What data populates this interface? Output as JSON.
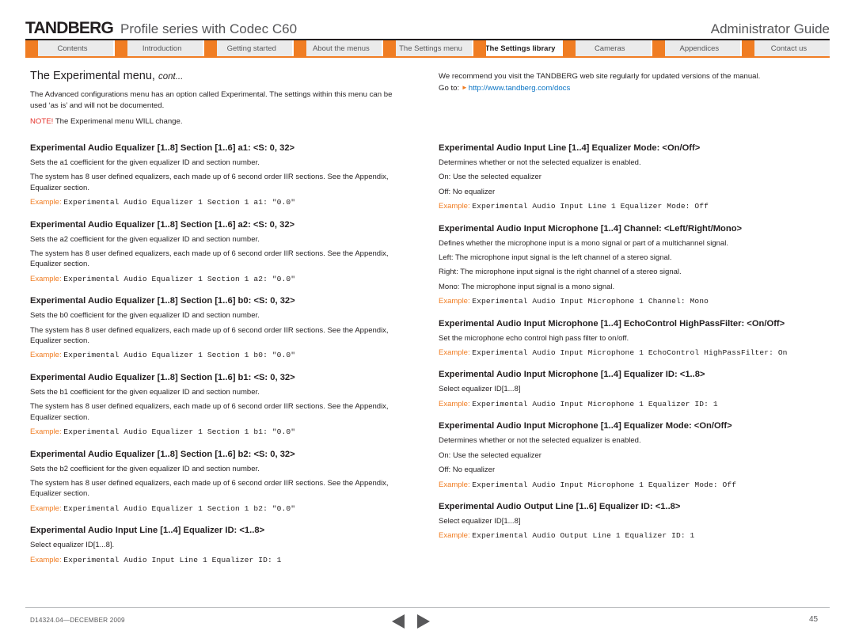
{
  "header": {
    "brand": "TANDBERG",
    "title": "Profile series with Codec C60",
    "guide": "Administrator Guide"
  },
  "tabs": [
    {
      "label": "Contents",
      "active": false
    },
    {
      "label": "Introduction",
      "active": false
    },
    {
      "label": "Getting started",
      "active": false
    },
    {
      "label": "About the menus",
      "active": false
    },
    {
      "label": "The Settings menu",
      "active": false
    },
    {
      "label": "The Settings library",
      "active": true
    },
    {
      "label": "Cameras",
      "active": false
    },
    {
      "label": "Appendices",
      "active": false
    },
    {
      "label": "Contact us",
      "active": false
    }
  ],
  "intro": {
    "title_main": "The Experimental menu, ",
    "title_cont": "cont...",
    "body": "The Advanced configurations menu has an option called Experimental. The settings within this menu can be used ‘as is’ and will not be documented.",
    "note_label": "NOTE!",
    "note_text": " The Experimenal menu WILL change.",
    "recommend": "We recommend you visit the TANDBERG web site regularly for updated versions of the manual.",
    "goto_label": "Go to:",
    "goto_link": "http://www.tandberg.com/docs"
  },
  "example_label": "Example:",
  "left_column": [
    {
      "title": "Experimental Audio Equalizer [1..8] Section [1..6] a1: <S: 0, 32>",
      "paras": [
        "Sets the a1 coefficient for the given equalizer ID and section number.",
        "The system has 8 user defined equalizers, each made up of 6 second order IIR sections. See the Appendix, Equalizer section."
      ],
      "example": "Experimental Audio Equalizer 1 Section 1 a1: \"0.0\""
    },
    {
      "title": "Experimental Audio Equalizer [1..8] Section [1..6] a2: <S: 0, 32>",
      "paras": [
        "Sets the a2 coefficient for the given equalizer ID and section number.",
        "The system has 8 user defined equalizers, each made up of 6 second order IIR sections. See the Appendix, Equalizer section."
      ],
      "example": "Experimental Audio Equalizer 1 Section 1 a2: \"0.0\""
    },
    {
      "title": "Experimental Audio Equalizer [1..8] Section [1..6] b0: <S: 0, 32>",
      "paras": [
        "Sets the b0 coefficient for the given equalizer ID and section number.",
        "The system has 8 user defined equalizers, each made up of 6 second order IIR sections. See the Appendix, Equalizer section."
      ],
      "example": "Experimental Audio Equalizer 1 Section 1 b0: \"0.0\""
    },
    {
      "title": "Experimental Audio Equalizer [1..8] Section [1..6] b1: <S: 0, 32>",
      "paras": [
        "Sets the b1 coefficient for the given equalizer ID and section number.",
        "The system has 8 user defined equalizers, each made up of 6 second order IIR sections. See the Appendix, Equalizer section."
      ],
      "example": "Experimental Audio Equalizer 1 Section 1 b1: \"0.0\""
    },
    {
      "title": "Experimental Audio Equalizer [1..8] Section [1..6] b2: <S: 0, 32>",
      "paras": [
        "Sets the b2 coefficient for the given equalizer ID and section number.",
        "The system has 8 user defined equalizers, each made up of 6 second order IIR sections. See the Appendix, Equalizer section."
      ],
      "example": "Experimental Audio Equalizer 1 Section 1 b2: \"0.0\""
    },
    {
      "title": "Experimental Audio Input Line [1..4] Equalizer ID: <1..8>",
      "paras": [
        "Select equalizer ID[1...8]."
      ],
      "example": "Experimental Audio Input Line 1 Equalizer ID: 1"
    }
  ],
  "right_column": [
    {
      "title": "Experimental Audio Input Line [1..4] Equalizer Mode: <On/Off>",
      "paras": [
        "Determines whether or not the selected equalizer is enabled.",
        "On: Use the selected equalizer",
        "Off: No equalizer"
      ],
      "example": "Experimental Audio Input Line 1 Equalizer Mode: Off"
    },
    {
      "title": "Experimental Audio Input Microphone [1..4] Channel: <Left/Right/Mono>",
      "paras": [
        "Defines whether the microphone input is a mono signal or part of a multichannel signal.",
        "Left: The microphone input signal is the left channel of a stereo signal.",
        "Right: The microphone input signal is the right channel of a stereo signal.",
        "Mono: The microphone input signal is a mono signal."
      ],
      "example": "Experimental Audio Input Microphone 1 Channel: Mono"
    },
    {
      "title": "Experimental Audio Input Microphone [1..4] EchoControl HighPassFilter: <On/Off>",
      "paras": [
        "Set the microphone echo control high pass filter to on/off."
      ],
      "example": "Experimental Audio Input Microphone 1 EchoControl HighPassFilter: On"
    },
    {
      "title": "Experimental Audio Input Microphone [1..4] Equalizer ID: <1..8>",
      "paras": [
        "Select equalizer ID[1...8]"
      ],
      "example": "Experimental Audio Input Microphone 1 Equalizer ID: 1"
    },
    {
      "title": "Experimental Audio Input Microphone [1..4] Equalizer Mode: <On/Off>",
      "paras": [
        "Determines whether or not the selected equalizer is enabled.",
        "On: Use the selected equalizer",
        "Off: No equalizer"
      ],
      "example": "Experimental Audio Input Microphone 1 Equalizer Mode: Off"
    },
    {
      "title": "Experimental Audio Output Line [1..6] Equalizer ID: <1..8>",
      "paras": [
        "Select equalizer ID[1...8]"
      ],
      "example": "Experimental Audio Output Line 1 Equalizer ID: 1"
    }
  ],
  "footer": {
    "doc_id": "D14324.04—DECEMBER 2009",
    "page_number": "45"
  }
}
